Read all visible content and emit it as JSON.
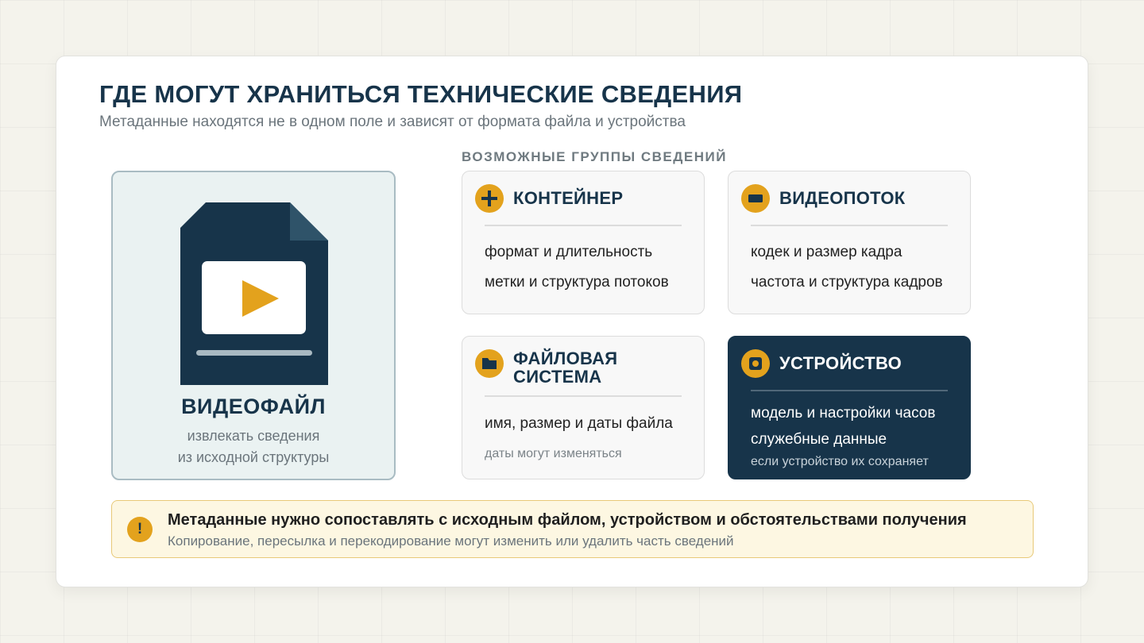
{
  "header": {
    "title": "ГДЕ МОГУТ ХРАНИТЬСЯ ТЕХНИЧЕСКИЕ СВЕДЕНИЯ",
    "subtitle": "Метаданные находятся не в одном поле и зависят от формата файла и устройства"
  },
  "file": {
    "title": "ВИДЕОФАЙЛ",
    "desc_line1": "извлекать сведения",
    "desc_line2": "из исходной структуры",
    "icon": "video-file-icon"
  },
  "groups": {
    "label": "ВОЗМОЖНЫЕ ГРУППЫ СВЕДЕНИЙ",
    "container": {
      "title": "КОНТЕЙНЕР",
      "icon": "plus-icon",
      "items": [
        "формат и длительность",
        "метки и структура потоков"
      ]
    },
    "video": {
      "title": "ВИДЕОПОТОК",
      "icon": "video-stream-icon",
      "items": [
        "кодек и размер кадра",
        "частота и структура кадров"
      ]
    },
    "filesystem": {
      "title_line1": "ФАЙЛОВАЯ",
      "title_line2": "СИСТЕМА",
      "icon": "folder-icon",
      "items": [
        "имя, размер и даты файла"
      ],
      "note": "даты могут изменяться"
    },
    "device": {
      "title": "УСТРОЙСТВО",
      "icon": "camera-icon",
      "items": [
        "модель и настройки часов",
        "служебные данные"
      ],
      "note": "если устройство их сохраняет"
    }
  },
  "warning": {
    "icon": "warning-icon",
    "symbol": "!",
    "main": "Метаданные нужно сопоставлять с исходным файлом, устройством и обстоятельствами получения",
    "sub": "Копирование, пересылка и перекодирование могут изменить или удалить часть сведений"
  },
  "colors": {
    "navy": "#17344a",
    "accent": "#e3a21d",
    "panel": "#eaf2f2",
    "warning_bg": "#fdf7e2"
  }
}
